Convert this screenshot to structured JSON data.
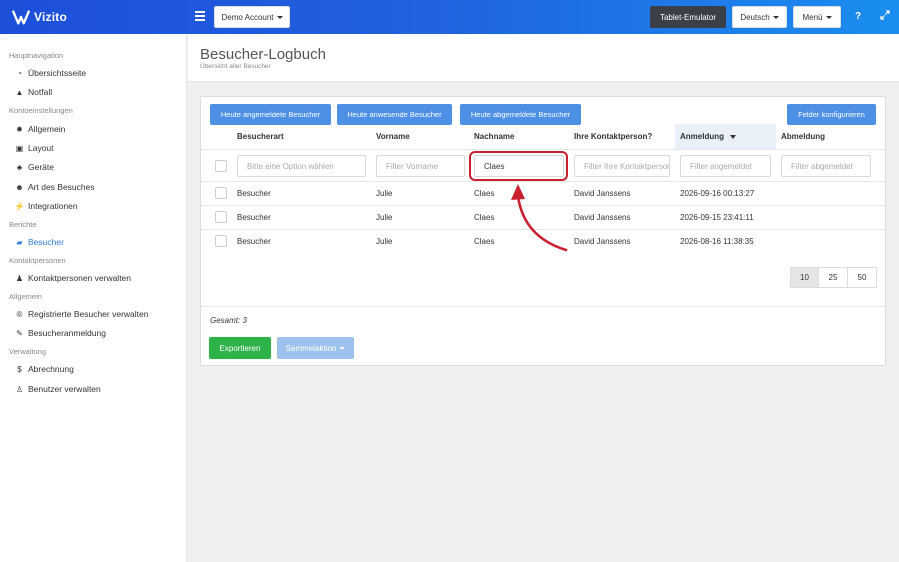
{
  "brand": {
    "name": "Vizito"
  },
  "topbar": {
    "account_label": "Demo Account",
    "tablet_label": "Tablet-Emulator",
    "language_label": "Deutsch",
    "menu_label": "Menü",
    "help_icon": "question-icon",
    "fullscreen_icon": "expand-icon"
  },
  "sidebar": {
    "sections": [
      {
        "title": "Hauptnavigation",
        "items": [
          {
            "label": "Übersichtsseite",
            "icon": "dashboard-icon"
          },
          {
            "label": "Notfall",
            "icon": "warning-icon"
          }
        ]
      },
      {
        "title": "Kontoeinstellungen",
        "items": [
          {
            "label": "Allgemein",
            "icon": "gear-icon"
          },
          {
            "label": "Layout",
            "icon": "image-icon"
          },
          {
            "label": "Geräte",
            "icon": "sitemap-icon"
          },
          {
            "label": "Art des Besuches",
            "icon": "users-icon"
          },
          {
            "label": "Integrationen",
            "icon": "plug-icon"
          }
        ]
      },
      {
        "title": "Berichte",
        "items": [
          {
            "label": "Besucher",
            "icon": "book-icon",
            "active": true
          }
        ]
      },
      {
        "title": "Kontaktpersonen",
        "items": [
          {
            "label": "Kontaktpersonen verwalten",
            "icon": "person-icon"
          }
        ]
      },
      {
        "title": "Allgemein",
        "items": [
          {
            "label": "Registrierte Besucher verwalten",
            "icon": "registered-icon"
          },
          {
            "label": "Besucheranmeldung",
            "icon": "pencil-icon"
          }
        ]
      },
      {
        "title": "Verwaltung",
        "items": [
          {
            "label": "Abrechnung",
            "icon": "dollar-icon"
          },
          {
            "label": "Benutzer verwalten",
            "icon": "user-plus-icon"
          }
        ]
      }
    ]
  },
  "page": {
    "title": "Besucher-Logbuch",
    "subtitle": "Übersicht aller Besucher"
  },
  "toolbar": {
    "btn_registered_today": "Heute angemeldete Besucher",
    "btn_present_today": "Heute anwesende Besucher",
    "btn_signed_out_today": "Heute abgemeldete Besucher",
    "btn_configure": "Felder konfigurieren"
  },
  "table": {
    "columns": [
      "Besucherart",
      "Vorname",
      "Nachname",
      "Ihre Kontaktperson?",
      "Anmeldung",
      "Abmeldung"
    ],
    "sorted_column": "Anmeldung",
    "filters": {
      "type_placeholder": "Bitte eine Option wählen",
      "firstname_placeholder": "Filter Vorname",
      "lastname_value": "Claes",
      "contact_placeholder": "Filter Ihre Kontaktperson",
      "signin_placeholder": "Filter angemeldet",
      "signout_placeholder": "Filter abgemeldet"
    },
    "rows": [
      {
        "type": "Besucher",
        "firstname": "Julie",
        "lastname": "Claes",
        "contact": "David Janssens",
        "signin": "2026-09-16 00:13:27",
        "signout": ""
      },
      {
        "type": "Besucher",
        "firstname": "Julie",
        "lastname": "Claes",
        "contact": "David Janssens",
        "signin": "2026-09-15 23:41:11",
        "signout": ""
      },
      {
        "type": "Besucher",
        "firstname": "Julie",
        "lastname": "Claes",
        "contact": "David Janssens",
        "signin": "2026-08-16 11:38:35",
        "signout": ""
      }
    ]
  },
  "pagination": {
    "sizes": [
      "10",
      "25",
      "50"
    ],
    "selected": "10"
  },
  "footer": {
    "total": "Gesamt: 3",
    "export_label": "Exportieren",
    "bulk_label": "Sammelaktion"
  },
  "colors": {
    "accent": "#4d90e6",
    "active_nav": "#2f7bd8",
    "export": "#2eb24a",
    "highlight": "#c8202e"
  }
}
